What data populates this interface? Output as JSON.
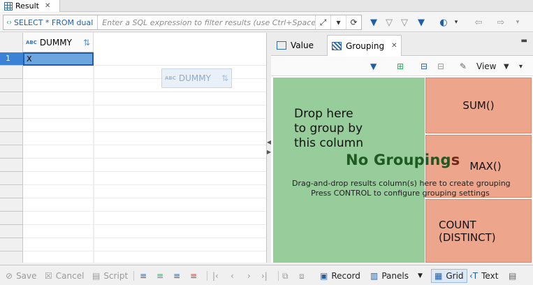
{
  "result_tab": {
    "label": "Result"
  },
  "filter_bar": {
    "query": "SELECT * FROM dual",
    "filter_placeholder": "Enter a SQL expression to filter results (use Ctrl+Space)"
  },
  "grid": {
    "column_header": "DUMMY",
    "column_type_badge": "ABC",
    "rows": [
      {
        "num": "1",
        "value": "X"
      }
    ],
    "drag_ghost_label": "DUMMY"
  },
  "panel": {
    "tabs": [
      {
        "label": "Value"
      },
      {
        "label": "Grouping"
      }
    ],
    "view_label": "View",
    "drop_zone_text": "Drop here\nto group by\nthis column",
    "func_sum": "SUM()",
    "func_max": "MAX()",
    "func_count": "COUNT\n(DISTINCT)",
    "no_groupings_head": "No Grouping",
    "no_groupings_tail": "s",
    "hint_line1": "Drag-and-drop results column(s) here to create grouping",
    "hint_line2": "Press CONTROL to configure grouping settings"
  },
  "bottom_bar": {
    "save": "Save",
    "cancel": "Cancel",
    "script": "Script",
    "record": "Record",
    "panels": "Panels",
    "grid": "Grid",
    "text": "Text"
  },
  "colors": {
    "drop_zone": "#97cc9b",
    "func_box": "#eda58b",
    "selection": "#3b82d6"
  }
}
